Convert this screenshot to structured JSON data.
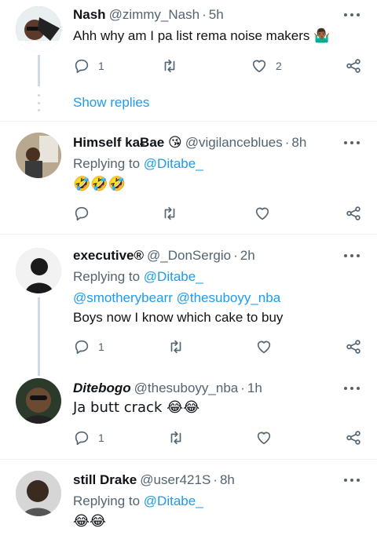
{
  "tweets": [
    {
      "name": "Nash",
      "handle": "@zimmy_Nash",
      "dot": "·",
      "time": "5h",
      "text": "Ahh why am I pa list rema noise makers 🤷🏾‍♂️",
      "reply_count": "1",
      "like_count": "2"
    },
    {
      "name": "Himself kaɃae 😘",
      "handle": "@vigilanceblues",
      "dot": "·",
      "time": "8h",
      "replying_label": "Replying to",
      "replying_to": "@Ditabe_",
      "text": "🤣🤣🤣"
    },
    {
      "name": "executive®",
      "handle": "@_DonSergio",
      "dot": "·",
      "time": "2h",
      "replying_label": "Replying to",
      "replying_to": "@Ditabe_",
      "mention1": "@smotherybearr",
      "mention2": "@thesuboyy_nba",
      "text": "Boys now I know which cake to buy",
      "reply_count": "1"
    },
    {
      "name": "Ditebogo",
      "handle": "@thesuboyy_nba",
      "dot": "·",
      "time": "1h",
      "text": "Ja butt crack 😂😂",
      "reply_count": "1"
    },
    {
      "name": "still Drake",
      "handle": "@user421S",
      "dot": "·",
      "time": "8h",
      "replying_label": "Replying to",
      "replying_to": "@Ditabe_",
      "text": "😂😂"
    }
  ],
  "show_replies": "Show replies",
  "icons": [
    "reply-icon",
    "retweet-icon",
    "like-icon",
    "share-icon",
    "more-icon"
  ],
  "colors": {
    "link": "#1d9bf0",
    "secondary": "#536471",
    "divider": "#eff3f4"
  }
}
